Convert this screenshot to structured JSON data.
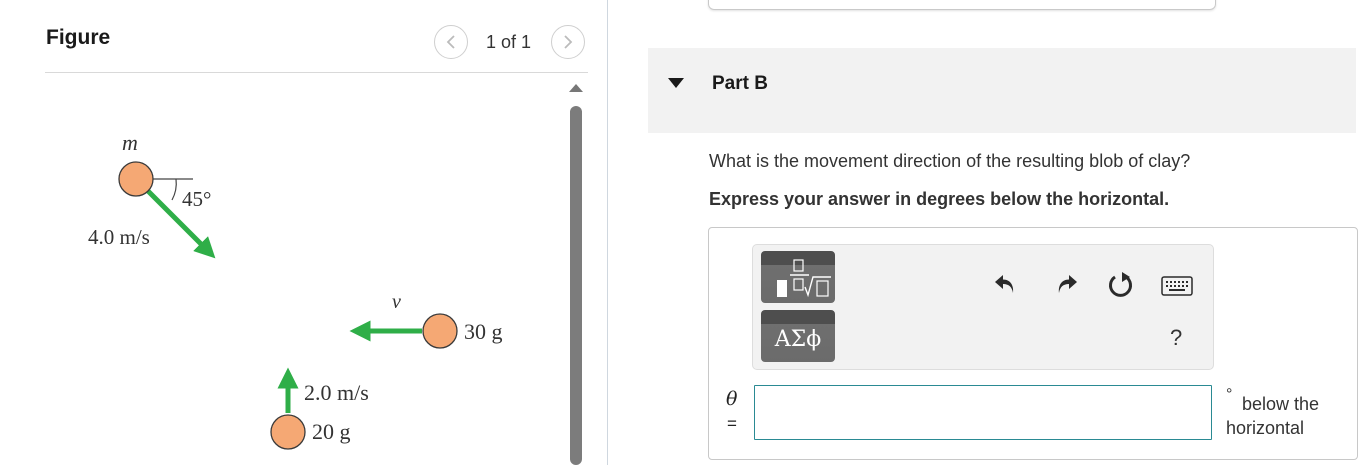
{
  "figure": {
    "title": "Figure",
    "pagination": "1 of 1",
    "labels": {
      "mass_m": "m",
      "angle": "45°",
      "speed_m": "4.0 m/s",
      "v": "v",
      "mass_30": "30 g",
      "speed_20": "2.0 m/s",
      "mass_20": "20 g"
    },
    "colors": {
      "ball": "#f5a874",
      "ball_outline": "#3a3a3a",
      "arrow": "#2fae48"
    }
  },
  "question": {
    "part_title": "Part B",
    "question_text": "What is the movement direction of the resulting blob of clay?",
    "instruction": "Express your answer in degrees below the horizontal.",
    "toolbar": {
      "templates_icon": "fraction-root-template-icon",
      "symbols_label": "ΑΣϕ",
      "undo_icon": "undo-icon",
      "redo_icon": "redo-icon",
      "reset_icon": "reset-icon",
      "keyboard_icon": "keyboard-icon",
      "help_label": "?"
    },
    "variable": "θ",
    "equals": "=",
    "answer_value": "",
    "degree_symbol": "°",
    "unit": "below the horizontal"
  }
}
